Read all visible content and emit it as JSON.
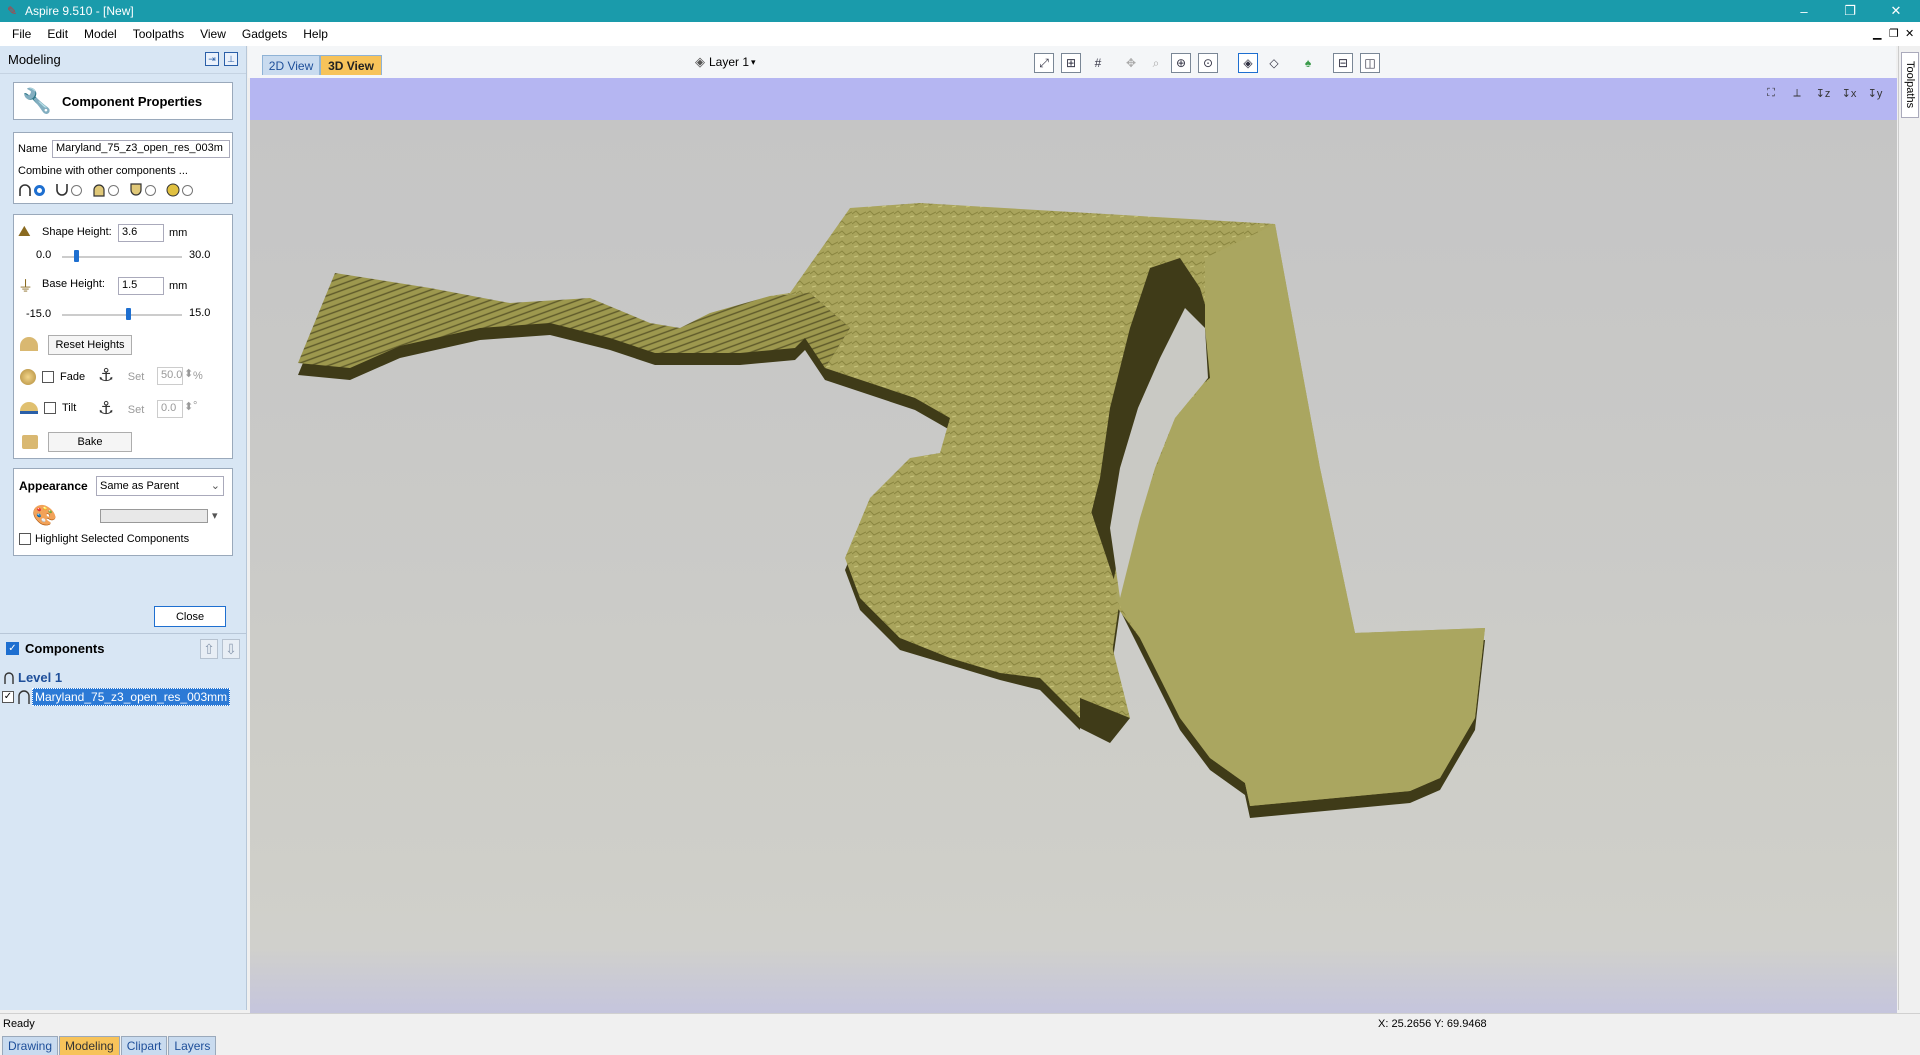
{
  "window": {
    "title": "Aspire 9.510 - [New]",
    "minimize": "–",
    "restore": "❐",
    "close": "✕"
  },
  "menu": [
    "File",
    "Edit",
    "Model",
    "Toolpaths",
    "View",
    "Gadgets",
    "Help"
  ],
  "left_panel": {
    "header": "Modeling",
    "component_properties": {
      "title": "Component Properties",
      "name_label": "Name",
      "name_value": "Maryland_75_z3_open_res_003m",
      "combine_label": "Combine with other components ...",
      "combine_selected": "add"
    },
    "heights": {
      "shape_label": "Shape Height:",
      "shape_value": "3.6",
      "shape_unit": "mm",
      "shape_min": "0.0",
      "shape_max": "30.0",
      "shape_fraction": 0.12,
      "base_label": "Base Height:",
      "base_value": "1.5",
      "base_unit": "mm",
      "base_min": "-15.0",
      "base_max": "15.0",
      "base_fraction": 0.55,
      "reset_label": "Reset Heights",
      "fade_label": "Fade",
      "fade_set": "Set",
      "fade_value": "50.0",
      "fade_unit": "%",
      "tilt_label": "Tilt",
      "tilt_set": "Set",
      "tilt_value": "0.0",
      "tilt_unit": "°",
      "bake_label": "Bake"
    },
    "appearance": {
      "label": "Appearance",
      "mode": "Same as Parent",
      "highlight_label": "Highlight Selected Components"
    },
    "close_label": "Close",
    "components": {
      "title": "Components",
      "level": "Level 1",
      "item": "Maryland_75_z3_open_res_003mm"
    },
    "tabs": [
      "Drawing",
      "Modeling",
      "Clipart",
      "Layers"
    ],
    "active_tab": "Modeling"
  },
  "toolbar": {
    "view_2d": "2D View",
    "view_3d": "3D View",
    "layer": "Layer 1"
  },
  "right_tab": "Toolpaths",
  "status": {
    "ready": "Ready",
    "coords": "X: 25.2656 Y: 69.9468"
  },
  "colors": {
    "titlebar": "#1a9bab",
    "model_surface": "#a8a45a",
    "model_shadow": "#4a4620",
    "sky": "#b5b6f2",
    "ground": "#cbcbc6"
  }
}
